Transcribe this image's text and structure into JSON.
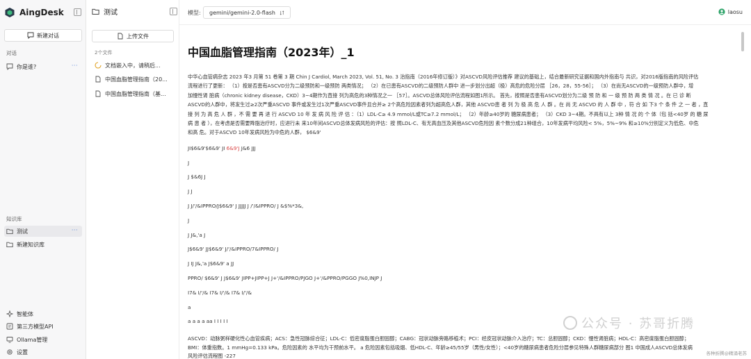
{
  "app": {
    "name": "AingDesk"
  },
  "sidebar": {
    "new_chat_label": "新建对话",
    "chat_section_label": "对话",
    "chats": [
      {
        "label": "你是谁?",
        "more": "···"
      }
    ],
    "kb_section_label": "知识库",
    "kbs": [
      {
        "label": "测试",
        "more": "···",
        "active": true
      },
      {
        "label": "新建知识库"
      }
    ],
    "bottom": [
      {
        "label": "智能体",
        "icon": "sparkle-icon"
      },
      {
        "label": "第三方模型API",
        "icon": "api-icon"
      },
      {
        "label": "Ollama管理",
        "icon": "monitor-icon"
      },
      {
        "label": "设置",
        "icon": "gear-icon"
      }
    ]
  },
  "panel": {
    "title": "测试",
    "upload_label": "上传文件",
    "file_count": "2个文件",
    "files": [
      {
        "label": "文档嵌入中，请稍后...",
        "status": "loading"
      },
      {
        "label": "中国血脂管理指南（20...",
        "status": "file"
      },
      {
        "label": "中国血脂管理指南（基...",
        "status": "file"
      }
    ]
  },
  "topbar": {
    "model_label": "模型:",
    "model_value": "gemini/gemini-2.0-flash",
    "user_name": "laosu"
  },
  "doc": {
    "title": "中国血脂管理指南（2023年）_1",
    "intro_l1": "中华心血管病杂志 2023 年3 月第 51 卷第 3 期  Chin J Cardiol, March 2023, Vol. 51, No. 3 治指南（2016年修订版）》对ASCVD风险评估推荐 建议的基础上，结合最新研究证据和国内外指南与 共识，对2016版指南的风险评估",
    "intro_l2": "流程进行了更新： （1）按是否患有ASCVD分为二级预防和一级预防 两类情况； （2）在已患有ASCVD的二级预防人群中 进一步划分出超（极）高危的危险分层 ［26，28，55-56］； （3）在尚无ASCVD的一级预防人群中，增",
    "intro_l3": "加慢性肾 脏病（chronic kidney disease，CKD）3~4期作为直接 列为高危的3种情况之一 ［57］。ASCVD总体风险评估流程如图1所示。 首先，按照是否患有ASCVD划分为二级 预 防 和 一 级 预 防 两 类 情 况 。在 已 诊 断",
    "intro_l4": "ASCVD的人群中，将发生过≥2次严重ASCVD 事件或发生过1次严重ASCVD事件且合并≥ 2个高危险因素者列为超高危人群，其他 ASCVD患 者 列 为 极 高 危 人 群 。在 尚 无 ASCVD 的 人 群 中 ，符 合 如 下3 个 条 件 之 一 者 ，直",
    "intro_l5": "接 列 为 高 危 人 群 ，不 需 要 再 进 行 ASCVD 10 年 发 病 风 险 评 估 ：（1）LDL-C≥ 4.9 mmol/L或TC≥7.2 mmol/L； （2）年龄≥40岁的 糖尿病患者； （3）CKD 3~4期。不具有以上 3种 情 况 的 个 体（包 括<40岁 的 糖 尿",
    "intro_l6": "病 患 者 ），在考虑是否需要降脂治疗时，应进行未 来10年间ASCVD总体发病风险的评估：按 照LDL-C、有无高血压及其他ASCVD危险因 素个数分成21种组合，10年发病平均风险< 5%，5%~9% 和≥10%分别定义为低危、中危",
    "intro_l7": "和高 危。对于ASCVD 10年发病风险为中危的人群， $6&9'",
    "garbled": [
      {
        "a": "JI$6&9'$6&9' JI ",
        "red": "6&9'J",
        "b": " J&6 JJJ"
      },
      {
        "a": "J"
      },
      {
        "a": "J $&6J J"
      },
      {
        "a": "J J"
      },
      {
        "a": "J J/'/&IPPRO/J$6&9' J JJJJJ J /'/&IPPRO/ J &$%*3&,"
      },
      {
        "a": "J"
      },
      {
        "a": "J J&,'a J"
      },
      {
        "a": "J$6&9' JJ$6&9' J/'/&IPPRO/7&IPPRO/ J"
      },
      {
        "a": "J IJ J&,'a J$6&9' a JJ"
      },
      {
        "a": "PPRO/ $6&9' J J$6&9' JIPP+JIPP+J J+'/&IPPRO/PJGO J+'/&PPRO/PGGO J%0,INJP J"
      },
      {
        "a": "I7& I/'/& I7& I/'/& I7& I/'/&"
      },
      {
        "a": "a"
      },
      {
        "a": "a a a a aa I I I I I"
      }
    ],
    "footer_l1": "ASCVD：动脉粥样硬化性心血管疾病；ACS：急性冠脉综合征；LDL-C：低密度脂蛋白胆固醇；CABG：冠状动脉旁路移植术；PCI：经皮冠状动脉介入治疗；TC：总胆固醇；CKD：慢性肾脏病；HDL-C：高密度脂蛋白胆固醇；",
    "footer_l2": "BMI：体重指数。1 mmHg=0.133 kPa。危险因素的 水平均为干预前水平。 a 危险因素包括吸烟、低HDL-C、年龄≥45/55岁（男性/女性）；<40岁的糖尿病患者危险分层参见特殊人群糖尿病部分 图1 中国成人ASCVD总体发病",
    "footer_l3": "风险评估流程图 -227"
  },
  "watermark": {
    "text": "公众号 · 苏哥折腾"
  },
  "credit": "各种折腾@精涌老苏"
}
